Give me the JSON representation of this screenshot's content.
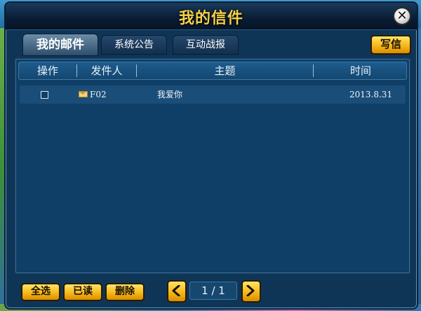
{
  "window": {
    "title": "我的信件",
    "close_label": "✕"
  },
  "tabs": [
    {
      "label": "我的邮件",
      "active": true
    },
    {
      "label": "系统公告",
      "active": false
    },
    {
      "label": "互动战报",
      "active": false
    }
  ],
  "toolbar": {
    "write_label": "写信"
  },
  "table": {
    "columns": [
      "操作",
      "发件人",
      "主题",
      "时间"
    ],
    "rows": [
      {
        "checked": false,
        "icon": "envelope-icon",
        "sender": "F02",
        "subject": "我爱你",
        "time": "2013.8.31"
      }
    ]
  },
  "footer": {
    "select_all_label": "全选",
    "read_label": "已读",
    "delete_label": "删除",
    "pagination": {
      "text": "1 / 1",
      "current": 1,
      "total": 1
    }
  },
  "colors": {
    "accent_gold": "#f5b81a",
    "title_gold": "#f3d24b",
    "panel_blue": "#0f3e66"
  }
}
